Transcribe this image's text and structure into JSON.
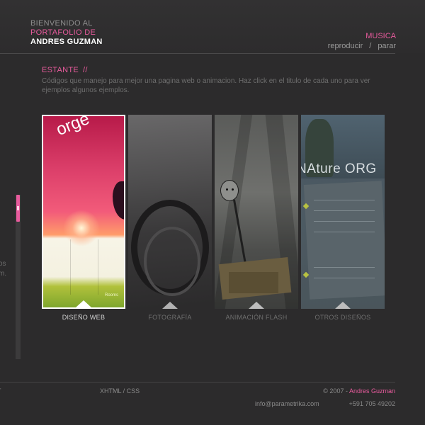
{
  "header": {
    "welcome": "BIENVENIDO AL",
    "portfolio": "PORTAFOLIO DE",
    "name": "ANDRES GUZMAN"
  },
  "music": {
    "title": "MUSICA",
    "play": "reproducir",
    "separator": "/",
    "stop": "parar"
  },
  "section": {
    "title": "ESTANTE",
    "slashes": "//",
    "description": "Códigos que manejo para mejor una pagina web o animacion. Haz click en el titulo de cada uno para ver ejemplos algunos ejemplos."
  },
  "side_text": {
    "line1": "os",
    "line2": "m."
  },
  "panels": [
    {
      "label": "DISEÑO WEB",
      "preview_word": "orge",
      "preview_tag": "Rooms",
      "active": true
    },
    {
      "label": "FOTOGRAFÍA",
      "active": false
    },
    {
      "label": "ANIMACIÓN FLASH",
      "active": false
    },
    {
      "label": "OTROS DISEÑOS",
      "preview_word": "NAture ORG",
      "active": false
    }
  ],
  "footer": {
    "left": "T",
    "xhtml": "XHTML / CSS",
    "copy_prefix": "©  2007 -",
    "copy_name": "Andres Guzman",
    "email": "info@parametrika.com",
    "phone": "+591 705 49202"
  },
  "colors": {
    "background": "#2c2b2c",
    "accent": "#e85b9d",
    "text": "#8a8a8a"
  }
}
